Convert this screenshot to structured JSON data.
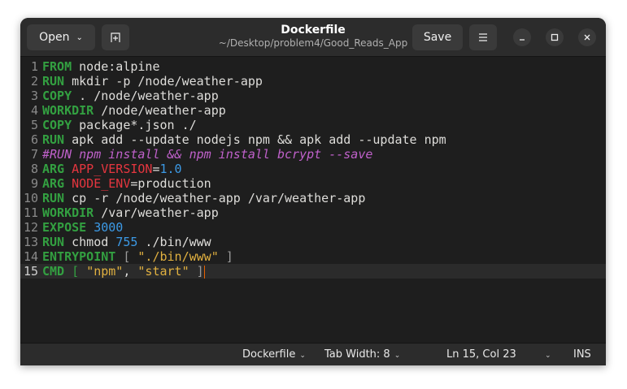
{
  "header": {
    "open_label": "Open",
    "title": "Dockerfile",
    "path": "~/Desktop/problem4/Good_Reads_App",
    "save_label": "Save"
  },
  "editor": {
    "current_line": 15,
    "lines": [
      [
        [
          "kw",
          "FROM"
        ],
        [
          "t",
          " node:alpine"
        ]
      ],
      [
        [
          "kw",
          "RUN"
        ],
        [
          "t",
          " mkdir -p /node/weather-app"
        ]
      ],
      [
        [
          "kw",
          "COPY"
        ],
        [
          "t",
          " . /node/weather-app"
        ]
      ],
      [
        [
          "kw",
          "WORKDIR"
        ],
        [
          "t",
          " /node/weather-app"
        ]
      ],
      [
        [
          "kw",
          "COPY"
        ],
        [
          "t",
          " package*.json ./"
        ]
      ],
      [
        [
          "kw",
          "RUN"
        ],
        [
          "t",
          " apk add --update nodejs npm && apk add --update npm"
        ]
      ],
      [
        [
          "cm",
          "#RUN npm install && npm install bcrypt --save"
        ]
      ],
      [
        [
          "kw",
          "ARG"
        ],
        [
          "t",
          " "
        ],
        [
          "var",
          "APP_VERSION"
        ],
        [
          "t",
          "="
        ],
        [
          "num",
          "1.0"
        ]
      ],
      [
        [
          "kw",
          "ARG"
        ],
        [
          "t",
          " "
        ],
        [
          "var",
          "NODE_ENV"
        ],
        [
          "t",
          "=production"
        ]
      ],
      [
        [
          "kw",
          "RUN"
        ],
        [
          "t",
          " cp -r /node/weather-app /var/weather-app"
        ]
      ],
      [
        [
          "kw",
          "WORKDIR"
        ],
        [
          "t",
          " /var/weather-app"
        ]
      ],
      [
        [
          "kw",
          "EXPOSE"
        ],
        [
          "t",
          " "
        ],
        [
          "num",
          "3000"
        ]
      ],
      [
        [
          "kw",
          "RUN"
        ],
        [
          "t",
          " chmod "
        ],
        [
          "num",
          "755"
        ],
        [
          "t",
          " ./bin/www"
        ]
      ],
      [
        [
          "kw",
          "ENTRYPOINT"
        ],
        [
          "t",
          " "
        ],
        [
          "br",
          "["
        ],
        [
          "t",
          " "
        ],
        [
          "str",
          "\"./bin/www\""
        ],
        [
          "t",
          " "
        ],
        [
          "br",
          "]"
        ]
      ],
      [
        [
          "kw",
          "CMD"
        ],
        [
          "t",
          " "
        ],
        [
          "brm",
          "["
        ],
        [
          "t",
          " "
        ],
        [
          "str",
          "\"npm\""
        ],
        [
          "t",
          ", "
        ],
        [
          "str",
          "\"start\""
        ],
        [
          "t",
          " "
        ],
        [
          "br",
          "]"
        ]
      ]
    ]
  },
  "status": {
    "language": "Dockerfile",
    "tab_width": "Tab Width: 8",
    "position": "Ln 15, Col 23",
    "mode": "INS"
  },
  "icons": {
    "open_chevron": "chevron-down-icon",
    "new_tab": "new-tab-icon",
    "menu": "hamburger-menu-icon",
    "minimize": "minimize-icon",
    "maximize": "maximize-icon",
    "close": "close-icon"
  }
}
